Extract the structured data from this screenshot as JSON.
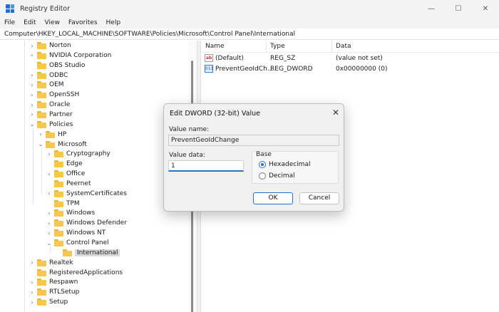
{
  "window": {
    "title": "Registry Editor",
    "minimize": "—",
    "maximize": "☐",
    "close": "✕"
  },
  "menu": [
    "File",
    "Edit",
    "View",
    "Favorites",
    "Help"
  ],
  "address": "Computer\\HKEY_LOCAL_MACHINE\\SOFTWARE\\Policies\\Microsoft\\Control Panel\\International",
  "tree": [
    {
      "label": "Norton",
      "chev": "›",
      "level": 0
    },
    {
      "label": "NVIDIA Corporation",
      "chev": "›",
      "level": 0
    },
    {
      "label": "OBS Studio",
      "chev": "",
      "level": 0
    },
    {
      "label": "ODBC",
      "chev": "›",
      "level": 0
    },
    {
      "label": "OEM",
      "chev": "›",
      "level": 0
    },
    {
      "label": "OpenSSH",
      "chev": "›",
      "level": 0
    },
    {
      "label": "Oracle",
      "chev": "›",
      "level": 0
    },
    {
      "label": "Partner",
      "chev": "›",
      "level": 0
    },
    {
      "label": "Policies",
      "chev": "⌄",
      "level": 0
    },
    {
      "label": "HP",
      "chev": "›",
      "level": 1
    },
    {
      "label": "Microsoft",
      "chev": "⌄",
      "level": 1
    },
    {
      "label": "Cryptography",
      "chev": "›",
      "level": 2
    },
    {
      "label": "Edge",
      "chev": "",
      "level": 2
    },
    {
      "label": "Office",
      "chev": "›",
      "level": 2
    },
    {
      "label": "Peernet",
      "chev": "",
      "level": 2
    },
    {
      "label": "SystemCertificates",
      "chev": "›",
      "level": 2
    },
    {
      "label": "TPM",
      "chev": "",
      "level": 2
    },
    {
      "label": "Windows",
      "chev": "›",
      "level": 2
    },
    {
      "label": "Windows Defender",
      "chev": "›",
      "level": 2
    },
    {
      "label": "Windows NT",
      "chev": "›",
      "level": 2
    },
    {
      "label": "Control Panel",
      "chev": "⌄",
      "level": 2
    },
    {
      "label": "International",
      "chev": "",
      "level": 3,
      "selected": true
    },
    {
      "label": "Realtek",
      "chev": "›",
      "level": 0
    },
    {
      "label": "RegisteredApplications",
      "chev": "",
      "level": 0
    },
    {
      "label": "Respawn",
      "chev": "›",
      "level": 0
    },
    {
      "label": "RTLSetup",
      "chev": "›",
      "level": 0
    },
    {
      "label": "Setup",
      "chev": "›",
      "level": 0
    }
  ],
  "list": {
    "headers": {
      "name": "Name",
      "type": "Type",
      "data": "Data"
    },
    "rows": [
      {
        "icon": "ab",
        "kind": "sz",
        "name": "(Default)",
        "type": "REG_SZ",
        "data": "(value not set)"
      },
      {
        "icon": "011",
        "kind": "dw",
        "name": "PreventGeoIdCh...",
        "type": "REG_DWORD",
        "data": "0x00000000 (0)"
      }
    ]
  },
  "dialog": {
    "title": "Edit DWORD (32-bit) Value",
    "close": "✕",
    "value_name_label": "Value name:",
    "value_name": "PreventGeoIdChange",
    "value_data_label": "Value data:",
    "value_data": "1",
    "base_label": "Base",
    "hex_label": "Hexadecimal",
    "dec_label": "Decimal",
    "ok": "OK",
    "cancel": "Cancel"
  }
}
